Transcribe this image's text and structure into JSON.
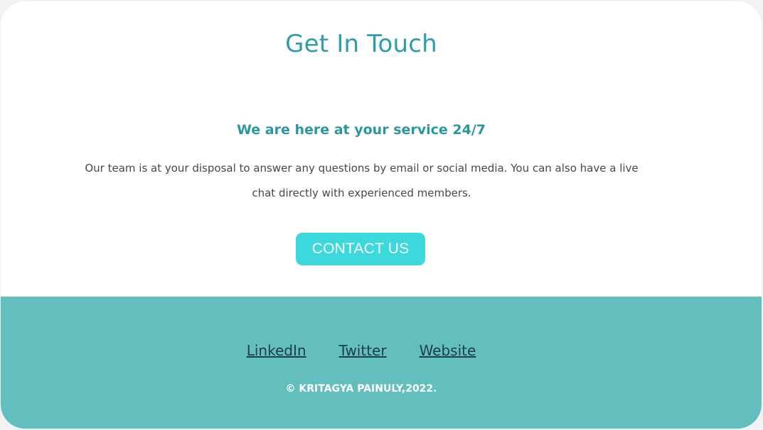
{
  "page": {
    "title": "Get In Touch",
    "subtitle": "We are here at your service 24/7",
    "description": "Our team is at your disposal to answer any questions by email or social media. You can also have a live chat directly with experienced members.",
    "cta_label": "CONTACT US"
  },
  "footer": {
    "links": [
      {
        "label": "LinkedIn"
      },
      {
        "label": "Twitter"
      },
      {
        "label": "Website"
      }
    ],
    "copyright": "© KRITAGYA PAINULY,2022."
  },
  "colors": {
    "accent": "#2e9ea3",
    "button": "#3cd9dc",
    "footer_bg": "#63bebe",
    "link": "#1d3d4a"
  }
}
